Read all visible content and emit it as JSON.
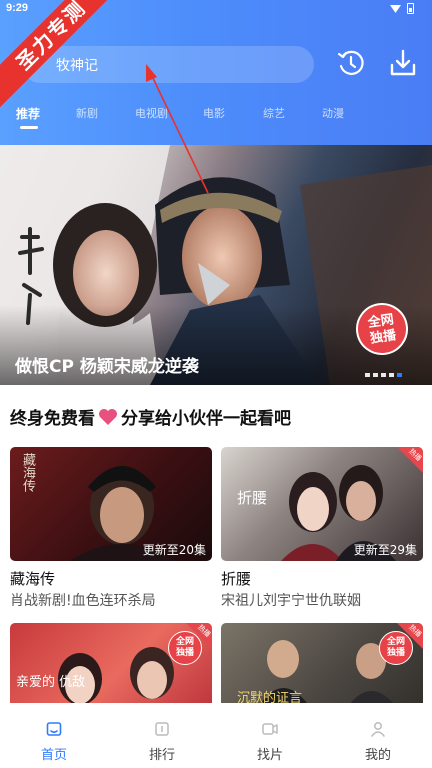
{
  "status": {
    "time": "9:29"
  },
  "watermark": {
    "text": "圣力专测"
  },
  "search": {
    "value": "牧神记"
  },
  "header_icons": {
    "history": "history-icon",
    "download": "download-icon"
  },
  "tabs": [
    {
      "label": "推荐",
      "active": true
    },
    {
      "label": "新剧"
    },
    {
      "label": "电视剧"
    },
    {
      "label": "电影"
    },
    {
      "label": "综艺"
    },
    {
      "label": "动漫"
    }
  ],
  "banner": {
    "title": "做恨CP 杨颖宋威龙逆袭",
    "badge": [
      "全网",
      "独播"
    ],
    "page_count": 5,
    "active_page": 4
  },
  "share": {
    "before": "终身免费看",
    "after": "分享给小伙伴一起看吧"
  },
  "cards": [
    {
      "title": "藏海传",
      "subtitle": "肖战新剧!血色连环杀局",
      "update": "更新至20集",
      "poster_text": "藏海传"
    },
    {
      "title": "折腰",
      "subtitle": "宋祖儿刘宇宁世仇联姻",
      "update": "更新至29集",
      "corner": "热播",
      "poster_text": "折腰"
    },
    {
      "poster_text": "亲爱的 仇敌",
      "corner": "热播",
      "badge": [
        "全网",
        "独播"
      ]
    },
    {
      "poster_text": "沉默的证言",
      "corner": "热播",
      "badge": [
        "全网",
        "独播"
      ]
    }
  ],
  "nav": [
    {
      "label": "首页",
      "icon": "home-icon",
      "active": true
    },
    {
      "label": "排行",
      "icon": "ranking-icon"
    },
    {
      "label": "找片",
      "icon": "video-icon"
    },
    {
      "label": "我的",
      "icon": "profile-icon"
    }
  ],
  "colors": {
    "accent": "#2f7bff",
    "badge": "#e64248",
    "heart": "#e8507f"
  }
}
